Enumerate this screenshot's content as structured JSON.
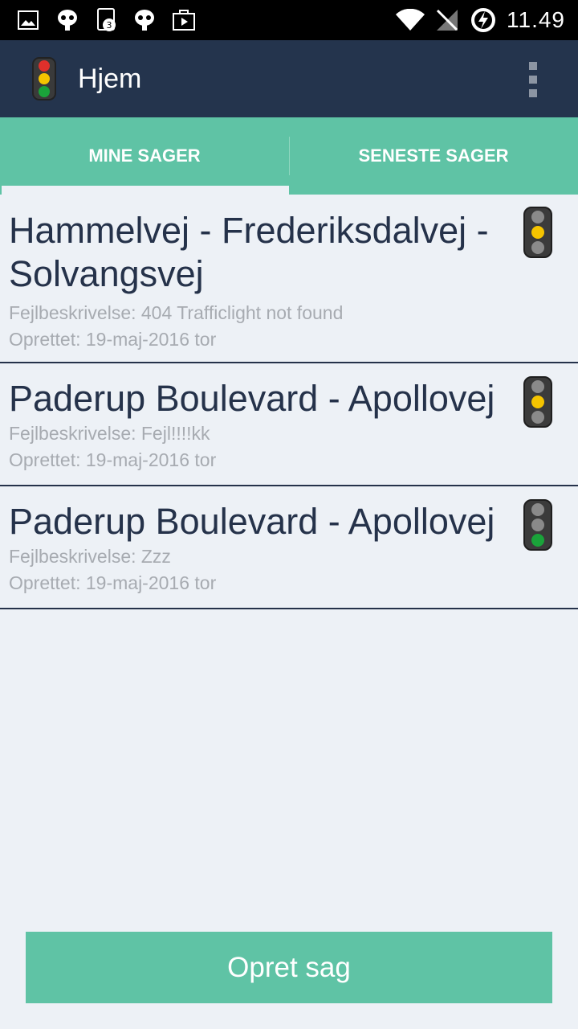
{
  "status_bar": {
    "time": "11.49",
    "notification_badge": "3",
    "icons": [
      "image-icon",
      "bug-icon",
      "clipboard-icon",
      "bug-icon",
      "play-store-icon",
      "wifi-icon",
      "no-signal-icon",
      "charging-icon"
    ]
  },
  "action_bar": {
    "title": "Hjem",
    "logo_icon": "traffic-light-icon",
    "menu_icon": "overflow-menu-icon"
  },
  "tabs": [
    {
      "label": "MINE SAGER",
      "selected": true
    },
    {
      "label": "SENESTE SAGER",
      "selected": false
    }
  ],
  "cases": [
    {
      "title": "Hammelvej - Frederiksdalvej - Solvangsvej",
      "description": "Fejlbeskrivelse: 404 Trafficlight not found",
      "created": "Oprettet: 19-maj-2016 tor",
      "light_status": "yellow"
    },
    {
      "title": "Paderup Boulevard - Apollovej",
      "description": "Fejlbeskrivelse: Fejl!!!!kk",
      "created": "Oprettet: 19-maj-2016 tor",
      "light_status": "yellow"
    },
    {
      "title": "Paderup Boulevard - Apollovej",
      "description": "Fejlbeskrivelse: Zzz",
      "created": "Oprettet: 19-maj-2016 tor",
      "light_status": "green"
    }
  ],
  "create_button": {
    "label": "Opret sag"
  },
  "colors": {
    "primary_dark": "#24344d",
    "accent": "#5fc3a5",
    "background": "#edf1f6",
    "light_yellow": "#f5c400",
    "light_green": "#1aa33a",
    "light_red": "#e0302b"
  }
}
